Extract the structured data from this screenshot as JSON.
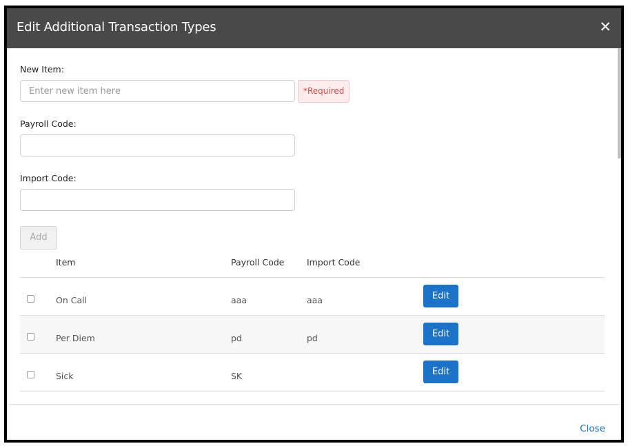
{
  "dialog": {
    "title": "Edit Additional Transaction Types",
    "close_icon": "close-icon",
    "close_glyph": "✕"
  },
  "form": {
    "new_item": {
      "label": "New Item:",
      "value": "",
      "placeholder": "Enter new item here"
    },
    "required_badge": "*Required",
    "payroll_code": {
      "label": "Payroll Code:",
      "value": ""
    },
    "import_code": {
      "label": "Import Code:",
      "value": ""
    },
    "add_button": "Add"
  },
  "table": {
    "headers": {
      "item": "Item",
      "payroll_code": "Payroll Code",
      "import_code": "Import Code"
    },
    "rows": [
      {
        "item": "On Call",
        "payroll_code": "aaa",
        "import_code": "aaa",
        "edit": "Edit"
      },
      {
        "item": "Per Diem",
        "payroll_code": "pd",
        "import_code": "pd",
        "edit": "Edit"
      },
      {
        "item": "Sick",
        "payroll_code": "SK",
        "import_code": "",
        "edit": "Edit"
      }
    ]
  },
  "footer": {
    "close_label": "Close"
  },
  "colors": {
    "header_bg": "#494949",
    "accent": "#1a73c8",
    "required_text": "#d64b4b"
  }
}
